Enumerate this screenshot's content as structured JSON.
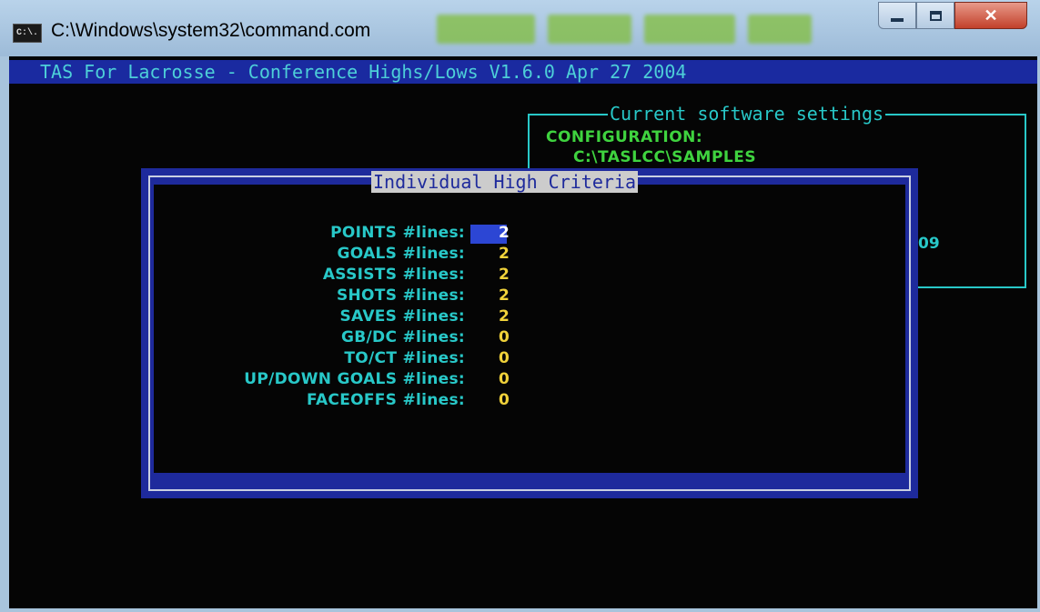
{
  "window": {
    "icon_label": "C:\\.",
    "title": "C:\\Windows\\system32\\command.com"
  },
  "console": {
    "header": "TAS For Lacrosse - Conference Highs/Lows V1.6.0 Apr 27 2004",
    "settings": {
      "title": "Current software settings",
      "config_label": "CONFIGURATION:",
      "config_path": "C:\\TASLCC\\SAMPLES",
      "partial_text": "09"
    }
  },
  "dialog": {
    "title": "Individual High Criteria",
    "rows": [
      {
        "label": "POINTS #lines:",
        "value": "2"
      },
      {
        "label": "GOALS #lines:",
        "value": "2"
      },
      {
        "label": "ASSISTS #lines:",
        "value": "2"
      },
      {
        "label": "SHOTS #lines:",
        "value": "2"
      },
      {
        "label": "SAVES #lines:",
        "value": "2"
      },
      {
        "label": "GB/DC #lines:",
        "value": "0"
      },
      {
        "label": "TO/CT #lines:",
        "value": "0"
      },
      {
        "label": "UP/DOWN GOALS #lines:",
        "value": "0"
      },
      {
        "label": "FACEOFFS #lines:",
        "value": "0"
      }
    ]
  },
  "colors": {
    "console_bg": "#050505",
    "dialog_blue": "#1e2a9c",
    "label_cyan": "#28c8c8",
    "value_yellow": "#f0d23a",
    "config_green": "#3fd33f",
    "cursor_blue": "#2c46d4"
  }
}
